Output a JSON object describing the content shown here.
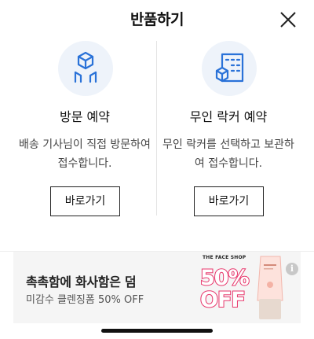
{
  "header": {
    "title": "반품하기",
    "close_icon": "close-icon"
  },
  "options": [
    {
      "icon": "delivery-box-icon",
      "title": "방문 예약",
      "description": "배송 기사님이 직접 방문하여 접수합니다.",
      "button_label": "바로가기"
    },
    {
      "icon": "locker-icon",
      "title": "무인 락커 예약",
      "description": "무인 락커를 선택하고 보관하여 접수합니다.",
      "button_label": "바로가기"
    }
  ],
  "ad": {
    "title": "촉촉함에 화사함은 덤",
    "subtitle": "미감수 클렌징폼 50% OFF",
    "brand": "THE FACE SHOP",
    "badge_line1": "50%",
    "badge_line2": "OFF",
    "info_icon": "info-icon"
  },
  "colors": {
    "icon_primary": "#2a72d8",
    "icon_bg": "#eef3fa",
    "badge_pink": "#e8356b",
    "ad_bg": "#f5f5f5"
  }
}
